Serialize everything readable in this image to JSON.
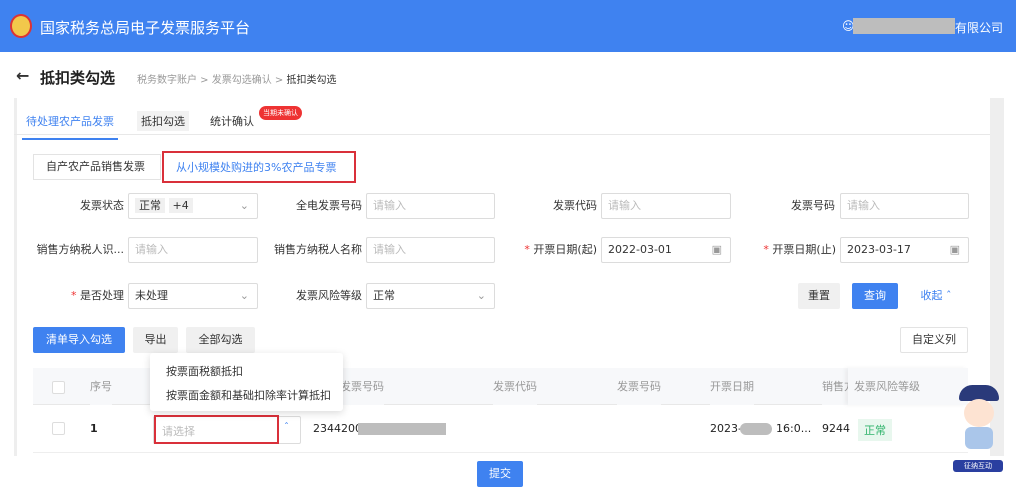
{
  "header": {
    "title": "国家税务总局电子发票服务平台",
    "company_suffix": "有限公司"
  },
  "page": {
    "title": "抵扣类勾选",
    "breadcrumb": [
      "税务数字账户",
      "发票勾选确认",
      "抵扣类勾选"
    ]
  },
  "tabs": [
    {
      "label": "待处理农产品发票",
      "active": true
    },
    {
      "label": "抵扣勾选"
    },
    {
      "label": "统计确认",
      "badge": "当期未确认"
    }
  ],
  "subtabs": [
    {
      "label": "自产农产品销售发票"
    },
    {
      "label": "从小规模处购进的3%农产品专票",
      "active": true
    }
  ],
  "form": {
    "invoice_status": {
      "label": "发票状态",
      "value": "正常",
      "extra": "+4"
    },
    "full_invoice_no": {
      "label": "全电发票号码",
      "placeholder": "请输入"
    },
    "invoice_code": {
      "label": "发票代码",
      "placeholder": "请输入"
    },
    "invoice_no": {
      "label": "发票号码",
      "placeholder": "请输入"
    },
    "seller_taxid": {
      "label": "销售方纳税人识...",
      "placeholder": "请输入"
    },
    "seller_name": {
      "label": "销售方纳税人名称",
      "placeholder": "请输入"
    },
    "date_start": {
      "label": "开票日期(起)",
      "value": "2022-03-01"
    },
    "date_end": {
      "label": "开票日期(止)",
      "value": "2023-03-17"
    },
    "processed": {
      "label": "是否处理",
      "value": "未处理"
    },
    "risk": {
      "label": "发票风险等级",
      "value": "正常"
    },
    "reset": "重置",
    "query": "查询",
    "collapse": "收起"
  },
  "toolbar": {
    "import": "清单导入勾选",
    "export": "导出",
    "select_all": "全部勾选",
    "custom_cols": "自定义列"
  },
  "table": {
    "headers": [
      "序号",
      "发票号码",
      "发票代码",
      "发票号码",
      "开票日期",
      "销售方",
      "发票风险等级"
    ],
    "rows": [
      {
        "index": "1",
        "select_placeholder": "请选择",
        "full_no": "2344200",
        "date_prefix": "2023-",
        "date_suffix": "16:0...",
        "seller": "9244",
        "risk": "正常"
      }
    ]
  },
  "dropdown": [
    "按票面税额抵扣",
    "按票面金额和基础扣除率计算抵扣"
  ],
  "submit": "提交",
  "mascot": {
    "label": "征纳互动"
  }
}
